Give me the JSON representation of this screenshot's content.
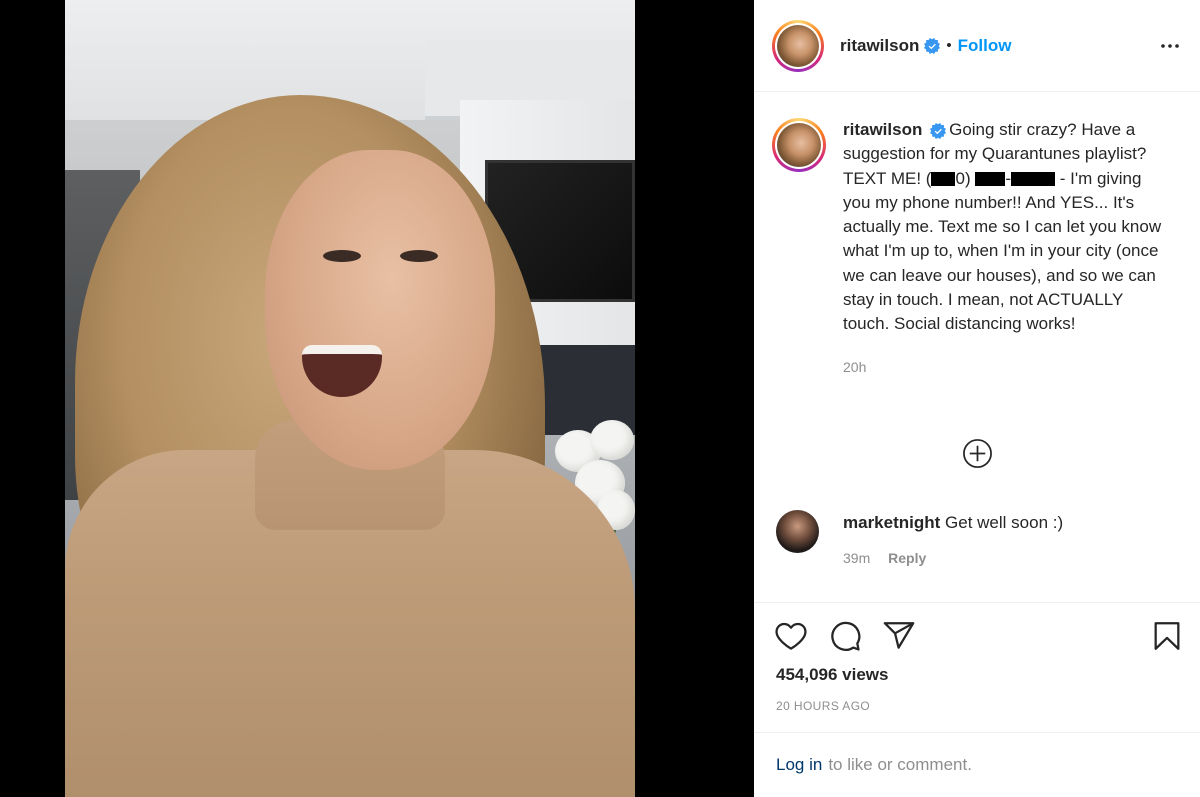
{
  "post": {
    "username": "ritawilson",
    "dot": "•",
    "follow_label": "Follow",
    "more_icon": "more-horizontal-icon"
  },
  "caption": {
    "username": "ritawilson",
    "part1": "Going stir crazy? Have a suggestion for my Quarantunes playlist? TEXT ME! (",
    "part2": "0)",
    "part3": "-",
    "part4": " - I'm giving you my phone number!! And YES... It's actually me. Text me so I can let you know what I'm up to, when I'm in your city (once we can leave our houses), and so we can stay in touch. I mean, not ACTUALLY touch. Social distancing works!",
    "time": "20h"
  },
  "comment": {
    "username": "marketnight",
    "text": "Get well soon :)",
    "time": "39m",
    "reply_label": "Reply"
  },
  "actions": {
    "views": "454,096 views",
    "timestamp": "20 HOURS AGO"
  },
  "login": {
    "link_label": "Log in",
    "suffix": "to like or comment."
  },
  "colors": {
    "link_blue": "#0095f6",
    "verified_blue": "#3897f0",
    "login_link": "#00376b",
    "muted": "#8e8e8e"
  }
}
